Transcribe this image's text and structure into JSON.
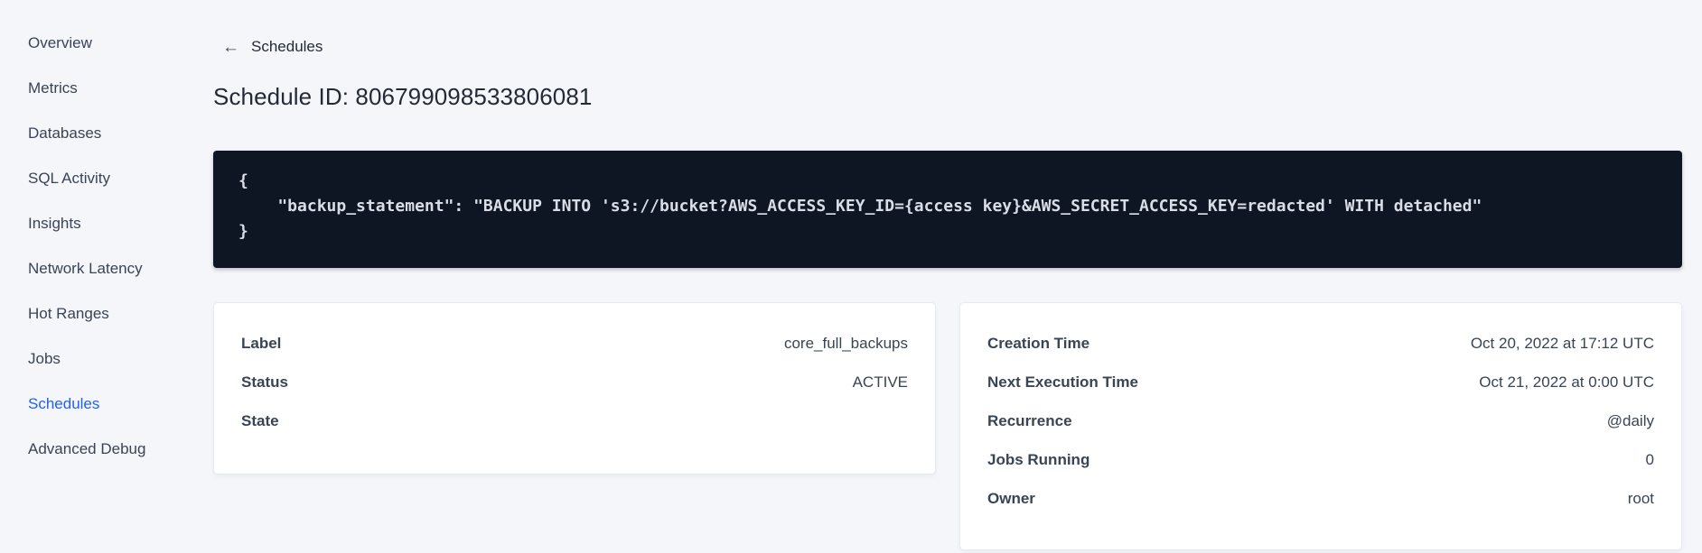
{
  "sidebar": {
    "items": [
      {
        "label": "Overview",
        "active": false
      },
      {
        "label": "Metrics",
        "active": false
      },
      {
        "label": "Databases",
        "active": false
      },
      {
        "label": "SQL Activity",
        "active": false
      },
      {
        "label": "Insights",
        "active": false
      },
      {
        "label": "Network Latency",
        "active": false
      },
      {
        "label": "Hot Ranges",
        "active": false
      },
      {
        "label": "Jobs",
        "active": false
      },
      {
        "label": "Schedules",
        "active": true
      },
      {
        "label": "Advanced Debug",
        "active": false
      }
    ]
  },
  "header": {
    "back_arrow": "←",
    "back_label": "Schedules",
    "title": "Schedule ID: 806799098533806081"
  },
  "code_block": {
    "lines": [
      "{",
      "    \"backup_statement\": \"BACKUP INTO 's3://bucket?AWS_ACCESS_KEY_ID={access key}&AWS_SECRET_ACCESS_KEY=redacted' WITH detached\"",
      "}"
    ]
  },
  "cards": {
    "left": {
      "rows": [
        {
          "label": "Label",
          "value": "core_full_backups"
        },
        {
          "label": "Status",
          "value": "ACTIVE"
        },
        {
          "label": "State",
          "value": ""
        }
      ]
    },
    "right": {
      "rows": [
        {
          "label": "Creation Time",
          "value": "Oct 20, 2022 at 17:12 UTC"
        },
        {
          "label": "Next Execution Time",
          "value": "Oct 21, 2022 at 0:00 UTC"
        },
        {
          "label": "Recurrence",
          "value": "@daily"
        },
        {
          "label": "Jobs Running",
          "value": "0"
        },
        {
          "label": "Owner",
          "value": "root"
        }
      ]
    }
  },
  "colors": {
    "page_background": "#f4f6fa",
    "active_nav_blue": "#2161f0",
    "text_dark": "#394455",
    "title_dark": "#242a35",
    "code_background": "#0e1624",
    "code_text": "#d9dee6",
    "card_background": "#ffffff",
    "card_border": "#e7ecf3"
  }
}
